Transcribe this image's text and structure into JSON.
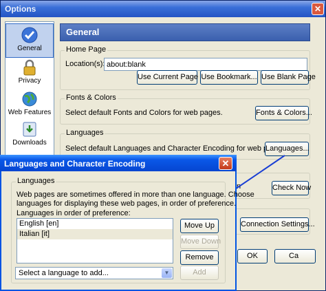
{
  "options": {
    "title": "Options",
    "sidebar": [
      {
        "label": "General",
        "icon": "checkmark-icon"
      },
      {
        "label": "Privacy",
        "icon": "lock-icon"
      },
      {
        "label": "Web Features",
        "icon": "globe-icon"
      },
      {
        "label": "Downloads",
        "icon": "downloads-icon"
      }
    ],
    "header": "General",
    "home_page": {
      "label": "Home Page",
      "location_label": "Location(s):",
      "location_value": "about:blank",
      "use_current": "Use Current Page",
      "use_bookmark": "Use Bookmark...",
      "use_blank": "Use Blank Page"
    },
    "fonts": {
      "label": "Fonts & Colors",
      "desc": "Select default Fonts and Colors for web pages.",
      "button": "Fonts & Colors..."
    },
    "languages": {
      "label": "Languages",
      "desc": "Select default Languages and Character Encoding for web pages.",
      "button": "Languages..."
    },
    "partial_text": "n",
    "check_now": "Check Now",
    "connection": "Connection Settings...",
    "ok": "OK",
    "cancel_partial": "Ca"
  },
  "dialog": {
    "title": "Languages and Character Encoding",
    "group_label": "Languages",
    "desc_line1": "Web pages are sometimes offered in more than one language. Choose",
    "desc_line2": "languages for displaying these web pages, in order of preference.",
    "list_label": "Languages in order of preference:",
    "languages": [
      "English  [en]",
      "Italian  [it]"
    ],
    "move_up": "Move Up",
    "move_down": "Move Down",
    "remove": "Remove",
    "select_placeholder": "Select a language to add...",
    "add": "Add"
  },
  "colors": {
    "arrow": "#1a3fd4",
    "titlebar_active": "#0a58e8"
  }
}
